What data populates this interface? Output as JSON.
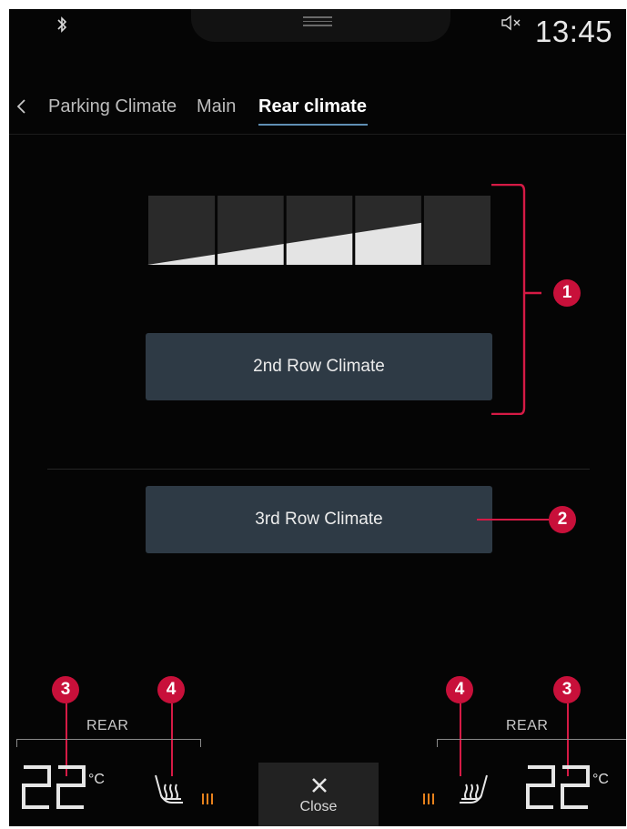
{
  "status_bar": {
    "time": "13:45",
    "icons": [
      "bluetooth-icon",
      "sound-muted-icon",
      "drag-handle-icon"
    ]
  },
  "nav": {
    "back_icon": "chevron-left-icon",
    "tabs": [
      {
        "label": "Parking Climate",
        "active": false
      },
      {
        "label": "Main",
        "active": false
      },
      {
        "label": "Rear climate",
        "active": true
      }
    ],
    "active_color": "#5f8fb4"
  },
  "fan_control": {
    "segments_total": 5,
    "level_fraction": 0.8
  },
  "buttons": {
    "second_row": "2nd Row Climate",
    "third_row": "3rd Row Climate"
  },
  "callouts": {
    "c1": "1",
    "c2": "2",
    "c3": "3",
    "c4": "4",
    "color": "#c8103a"
  },
  "bottom_bar": {
    "left": {
      "label": "REAR",
      "temperature": "22",
      "unit": "°C",
      "seat_heat_level": 3
    },
    "right": {
      "label": "REAR",
      "temperature": "22",
      "unit": "°C",
      "seat_heat_level": 3
    },
    "close_label": "Close",
    "heat_color": "#e8821c"
  }
}
